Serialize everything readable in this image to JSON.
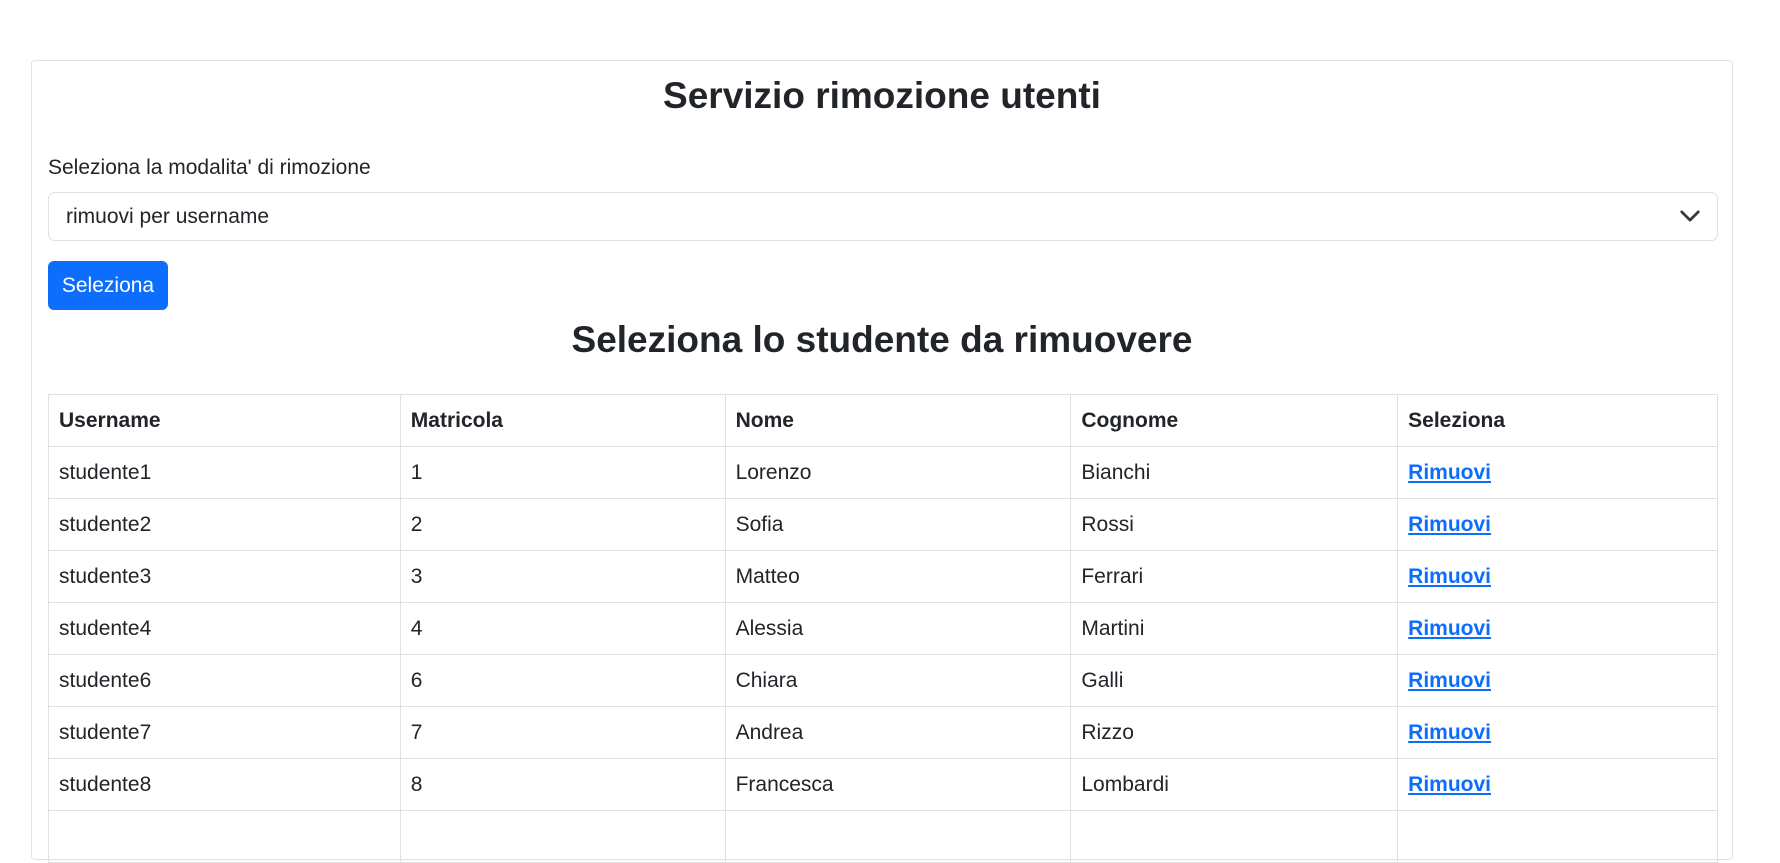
{
  "header": {
    "title": "Servizio rimozione utenti"
  },
  "form": {
    "label": "Seleziona la modalita' di rimozione",
    "selected_option": "rimuovi per username",
    "submit_label": "Seleziona"
  },
  "section": {
    "title": "Seleziona lo studente da rimuovere"
  },
  "table": {
    "headers": [
      "Username",
      "Matricola",
      "Nome",
      "Cognome",
      "Seleziona"
    ],
    "rows": [
      {
        "username": "studente1",
        "matricola": "1",
        "nome": "Lorenzo",
        "cognome": "Bianchi",
        "action": "Rimuovi"
      },
      {
        "username": "studente2",
        "matricola": "2",
        "nome": "Sofia",
        "cognome": "Rossi",
        "action": "Rimuovi"
      },
      {
        "username": "studente3",
        "matricola": "3",
        "nome": "Matteo",
        "cognome": "Ferrari",
        "action": "Rimuovi"
      },
      {
        "username": "studente4",
        "matricola": "4",
        "nome": "Alessia",
        "cognome": "Martini",
        "action": "Rimuovi"
      },
      {
        "username": "studente6",
        "matricola": "6",
        "nome": "Chiara",
        "cognome": "Galli",
        "action": "Rimuovi"
      },
      {
        "username": "studente7",
        "matricola": "7",
        "nome": "Andrea",
        "cognome": "Rizzo",
        "action": "Rimuovi"
      },
      {
        "username": "studente8",
        "matricola": "8",
        "nome": "Francesca",
        "cognome": "Lombardi",
        "action": "Rimuovi"
      }
    ]
  },
  "colors": {
    "primary": "#0d6efd",
    "border": "#dee2e6",
    "text": "#212529"
  },
  "icons": {
    "select_caret": "chevron-down-icon"
  }
}
